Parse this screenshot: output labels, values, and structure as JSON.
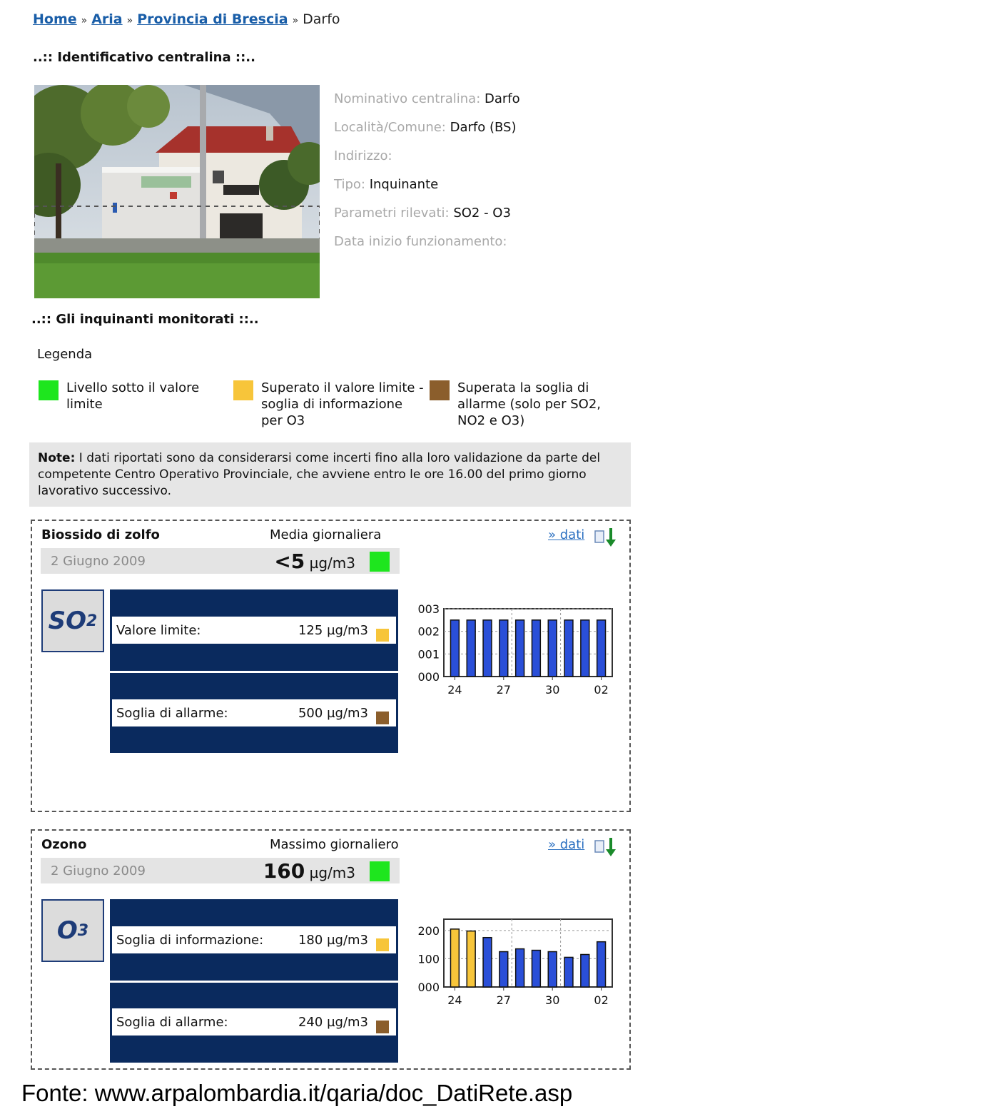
{
  "breadcrumb": {
    "items": [
      "Home",
      "Aria",
      "Provincia di Brescia"
    ],
    "separator": "»",
    "current": "Darfo"
  },
  "sections": {
    "identificativo": "..:: Identificativo centralina ::..",
    "inquinanti": "..:: Gli inquinanti monitorati ::.."
  },
  "station": {
    "fields": [
      {
        "label": "Nominativo centralina:",
        "value": "Darfo"
      },
      {
        "label": "Località/Comune:",
        "value": "Darfo (BS)"
      },
      {
        "label": "Indirizzo:",
        "value": ""
      },
      {
        "label": "Tipo:",
        "value": "Inquinante"
      },
      {
        "label": "Parametri rilevati:",
        "value": "SO2 - O3"
      },
      {
        "label": "Data inizio funzionamento:",
        "value": ""
      }
    ]
  },
  "legend": {
    "title": "Legenda",
    "items": [
      {
        "text": "Livello sotto il valore limite",
        "color": "#1ee61e"
      },
      {
        "text": "Superato il valore limite - soglia di informazione per O3",
        "color": "#f7c53a"
      },
      {
        "text": "Superata la soglia di allarme (solo per SO2, NO2 e O3)",
        "color": "#8b5e2c"
      }
    ]
  },
  "note": {
    "bold": "Note:",
    "text": " I dati riportati sono da considerarsi come incerti fino alla loro validazione da parte del competente Centro Operativo Provinciale, che avviene entro le ore 16.00 del primo giorno lavorativo successivo."
  },
  "panels": [
    {
      "title": "Biossido di zolfo",
      "metric": "Media giornaliera",
      "link": "» dati",
      "date": "2 Giugno 2009",
      "value": "<5",
      "unit": "µg/m3",
      "symbol": "SO",
      "symbol_sub": "2",
      "rows": [
        {
          "label": "Valore limite:",
          "value": "125 µg/m3",
          "color": "#f7c53a"
        },
        {
          "label": "Soglia di allarme:",
          "value": "500 µg/m3",
          "color": "#8b5e2c"
        }
      ]
    },
    {
      "title": "Ozono",
      "metric": "Massimo giornaliero",
      "link": "» dati",
      "date": "2 Giugno 2009",
      "value": "160",
      "unit": "µg/m3",
      "symbol": "O",
      "symbol_sub": "3",
      "rows": [
        {
          "label": "Soglia di informazione:",
          "value": "180 µg/m3",
          "color": "#f7c53a"
        },
        {
          "label": "Soglia di allarme:",
          "value": "240 µg/m3",
          "color": "#8b5e2c"
        }
      ]
    }
  ],
  "chart_data": [
    {
      "type": "bar",
      "x_tick_labels": [
        "24",
        "27",
        "30",
        "02"
      ],
      "y_tick_labels": [
        "000",
        "001",
        "002",
        "003"
      ],
      "ylim": [
        0,
        3
      ],
      "values": [
        2.5,
        2.5,
        2.5,
        2.5,
        2.5,
        2.5,
        2.5,
        2.5,
        2.5,
        2.5
      ],
      "bar_colors": [
        "#2a4fd8",
        "#2a4fd8",
        "#2a4fd8",
        "#2a4fd8",
        "#2a4fd8",
        "#2a4fd8",
        "#2a4fd8",
        "#2a4fd8",
        "#2a4fd8",
        "#2a4fd8"
      ],
      "grid": true
    },
    {
      "type": "bar",
      "x_tick_labels": [
        "24",
        "27",
        "30",
        "02"
      ],
      "y_tick_labels": [
        "000",
        "100",
        "200"
      ],
      "ylim": [
        0,
        240
      ],
      "values": [
        205,
        198,
        175,
        125,
        135,
        130,
        125,
        105,
        115,
        160
      ],
      "bar_colors": [
        "#f7c53a",
        "#f7c53a",
        "#2a4fd8",
        "#2a4fd8",
        "#2a4fd8",
        "#2a4fd8",
        "#2a4fd8",
        "#2a4fd8",
        "#2a4fd8",
        "#2a4fd8"
      ],
      "grid": true
    }
  ],
  "footer": {
    "source": "Fonte: www.arpalombardia.it/qaria/doc_DatiRete.asp"
  }
}
